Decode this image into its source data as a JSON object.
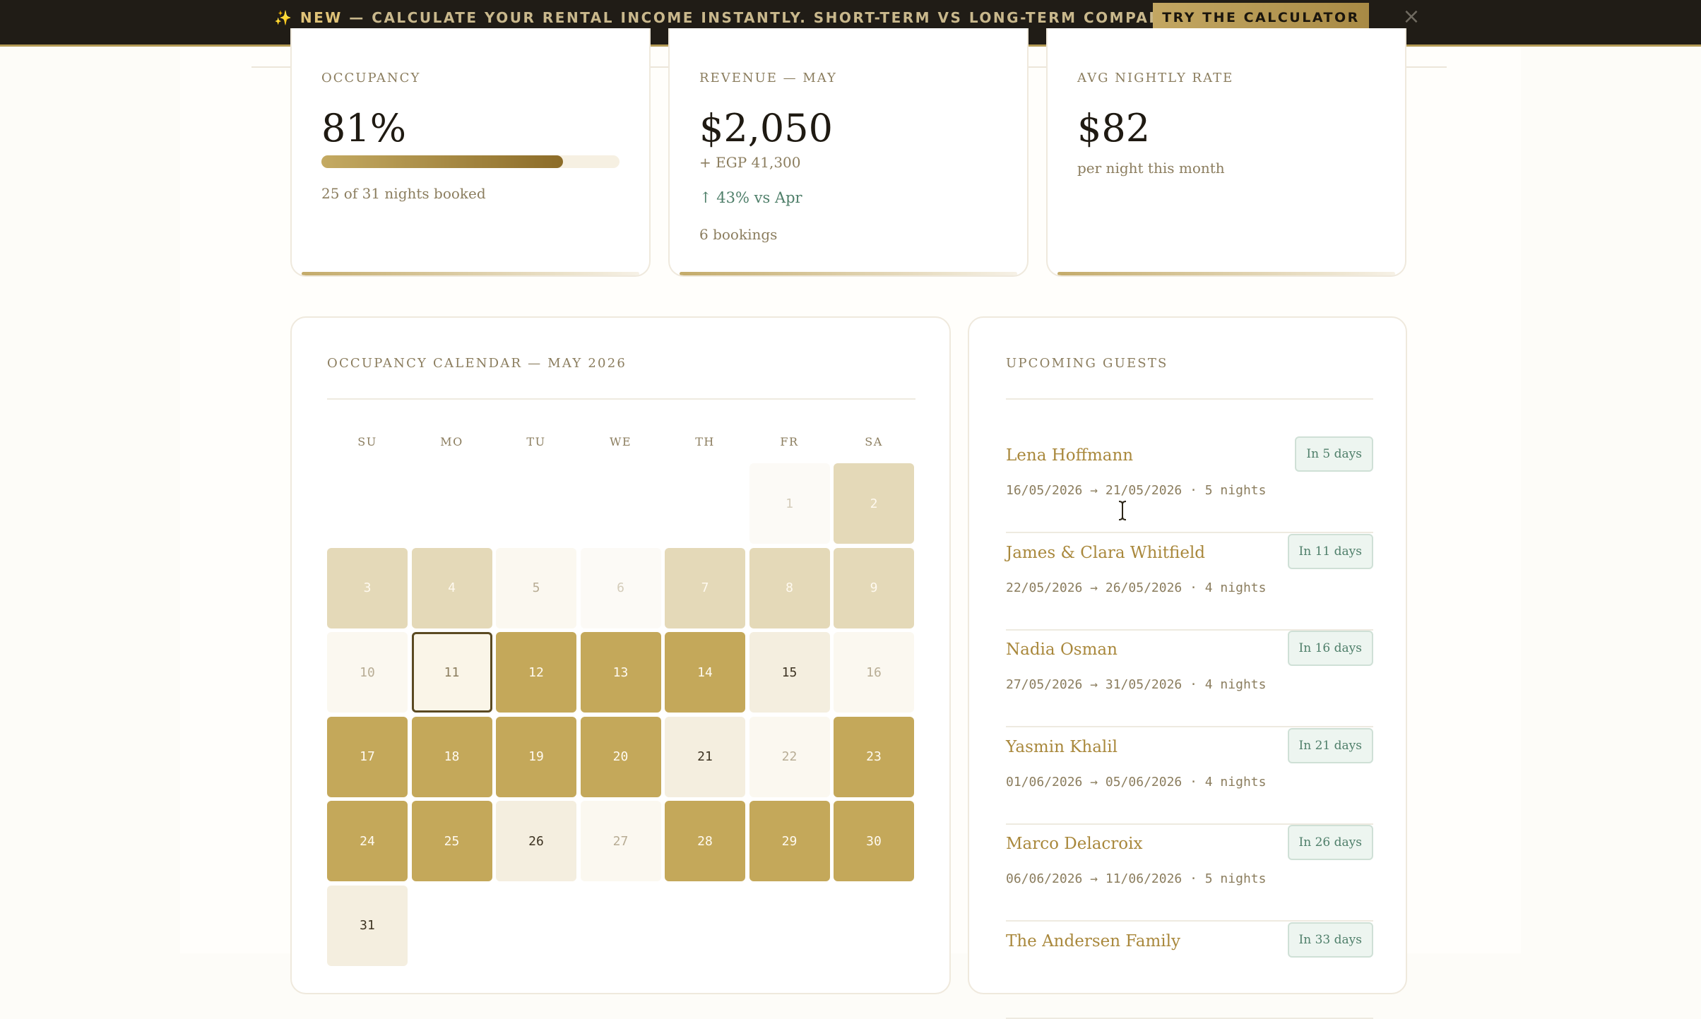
{
  "banner": {
    "spark": "✨",
    "new_label": "NEW",
    "message": " — CALCULATE YOUR RENTAL INCOME INSTANTLY. SHORT-TERM VS LONG-TERM COMPARISON.",
    "cta_label": "TRY THE CALCULATOR",
    "close_icon": "×"
  },
  "stats": {
    "occupancy": {
      "label": "OCCUPANCY",
      "value": "81%",
      "fill_fraction": 0.81,
      "detail": "25 of 31 nights booked"
    },
    "revenue": {
      "label": "REVENUE — MAY",
      "value": "$2,050",
      "secondary": "+ EGP 41,300",
      "change": "↑ 43% vs Apr",
      "bookings": "6 bookings"
    },
    "rate": {
      "label": "AVG NIGHTLY RATE",
      "value": "$82",
      "detail": "per night this month"
    }
  },
  "calendar": {
    "title": "OCCUPANCY CALENDAR — MAY 2026",
    "weekdays": [
      "SU",
      "MO",
      "TU",
      "WE",
      "TH",
      "FR",
      "SA"
    ],
    "first_weekday_index": 5,
    "days": [
      {
        "d": "1",
        "s": "past"
      },
      {
        "d": "2",
        "s": "partial"
      },
      {
        "d": "3",
        "s": "partial"
      },
      {
        "d": "4",
        "s": "partial"
      },
      {
        "d": "5",
        "s": "available"
      },
      {
        "d": "6",
        "s": "past"
      },
      {
        "d": "7",
        "s": "partial"
      },
      {
        "d": "8",
        "s": "partial"
      },
      {
        "d": "9",
        "s": "partial"
      },
      {
        "d": "10",
        "s": "available"
      },
      {
        "d": "11",
        "s": "today"
      },
      {
        "d": "12",
        "s": "booked"
      },
      {
        "d": "13",
        "s": "booked"
      },
      {
        "d": "14",
        "s": "booked"
      },
      {
        "d": "15",
        "s": "light"
      },
      {
        "d": "16",
        "s": "available"
      },
      {
        "d": "17",
        "s": "booked"
      },
      {
        "d": "18",
        "s": "booked"
      },
      {
        "d": "19",
        "s": "booked"
      },
      {
        "d": "20",
        "s": "booked"
      },
      {
        "d": "21",
        "s": "light"
      },
      {
        "d": "22",
        "s": "available"
      },
      {
        "d": "23",
        "s": "booked"
      },
      {
        "d": "24",
        "s": "booked"
      },
      {
        "d": "25",
        "s": "booked"
      },
      {
        "d": "26",
        "s": "light"
      },
      {
        "d": "27",
        "s": "available"
      },
      {
        "d": "28",
        "s": "booked"
      },
      {
        "d": "29",
        "s": "booked"
      },
      {
        "d": "30",
        "s": "booked"
      },
      {
        "d": "31",
        "s": "light"
      }
    ]
  },
  "guests": {
    "title": "UPCOMING GUESTS",
    "items": [
      {
        "name": "Lena Hoffmann",
        "dates": "16/05/2026 → 21/05/2026 · 5 nights",
        "badge": "In 5 days"
      },
      {
        "name": "James & Clara Whitfield",
        "dates": "22/05/2026 → 26/05/2026 · 4 nights",
        "badge": "In 11 days"
      },
      {
        "name": "Nadia Osman",
        "dates": "27/05/2026 → 31/05/2026 · 4 nights",
        "badge": "In 16 days"
      },
      {
        "name": "Yasmin Khalil",
        "dates": "01/06/2026 → 05/06/2026 · 4 nights",
        "badge": "In 21 days"
      },
      {
        "name": "Marco Delacroix",
        "dates": "06/06/2026 → 11/06/2026 · 5 nights",
        "badge": "In 26 days"
      },
      {
        "name": "The Andersen Family",
        "dates": "",
        "badge": "In 33 days"
      }
    ]
  },
  "colors": {
    "accent_gold": "#c4a85a",
    "banner_bg": "#201c16",
    "badge_green": "#4f7f6a"
  }
}
